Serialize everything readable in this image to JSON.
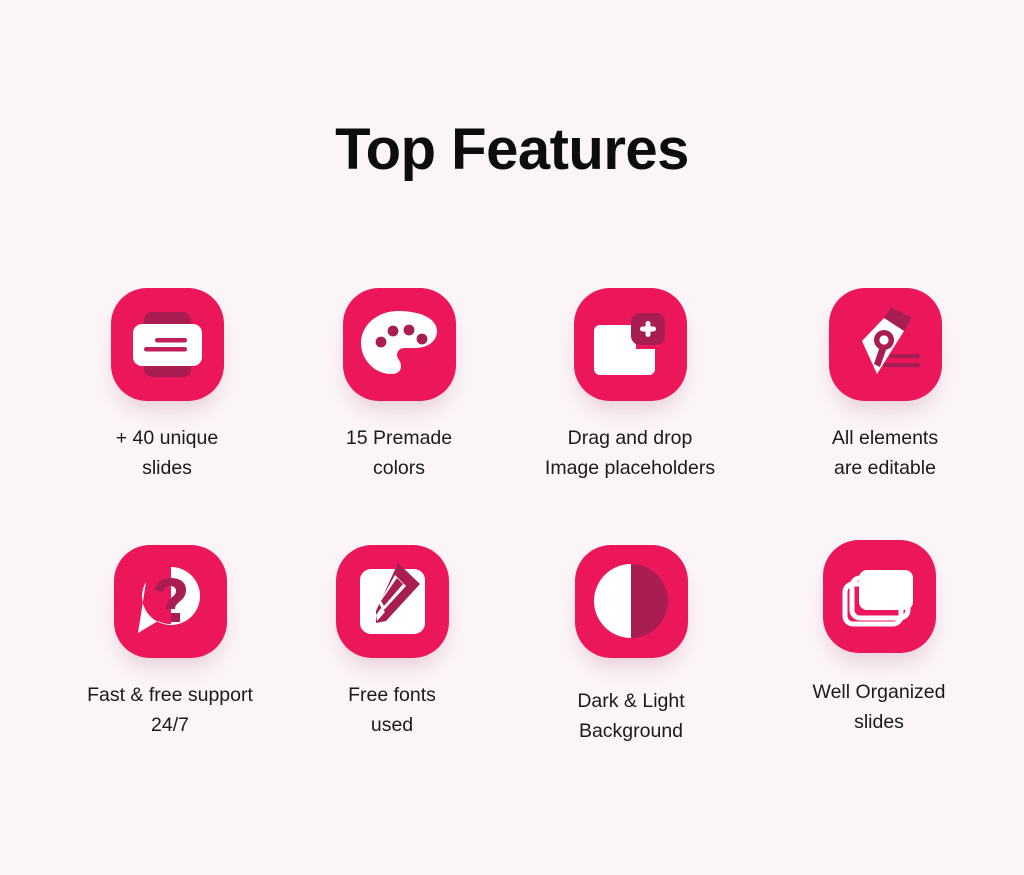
{
  "page": {
    "title": "Top Features",
    "background_color": "#fcf5f7",
    "accent_color": "#ec175b",
    "accent_dark_color": "#a81e52",
    "icon_fill_color": "#ffffff",
    "text_color": "#1a1a1a"
  },
  "features": [
    {
      "icon": "slide-card-icon",
      "line1": "+ 40 unique",
      "line2": "slides"
    },
    {
      "icon": "color-palette-icon",
      "line1": "15 Premade",
      "line2": "colors"
    },
    {
      "icon": "image-placeholder-add-icon",
      "line1": "Drag and drop",
      "line2": "Image placeholders"
    },
    {
      "icon": "pen-nib-icon",
      "line1": "All elements",
      "line2": "are editable"
    },
    {
      "icon": "question-speech-bubble-icon",
      "line1": "Fast & free support",
      "line2": "24/7"
    },
    {
      "icon": "pencil-edit-square-icon",
      "line1": "Free fonts",
      "line2": "used"
    },
    {
      "icon": "half-circle-contrast-icon",
      "line1": "Dark & Light",
      "line2": "Background"
    },
    {
      "icon": "stacked-slides-icon",
      "line1": "Well Organized",
      "line2": "slides"
    }
  ]
}
